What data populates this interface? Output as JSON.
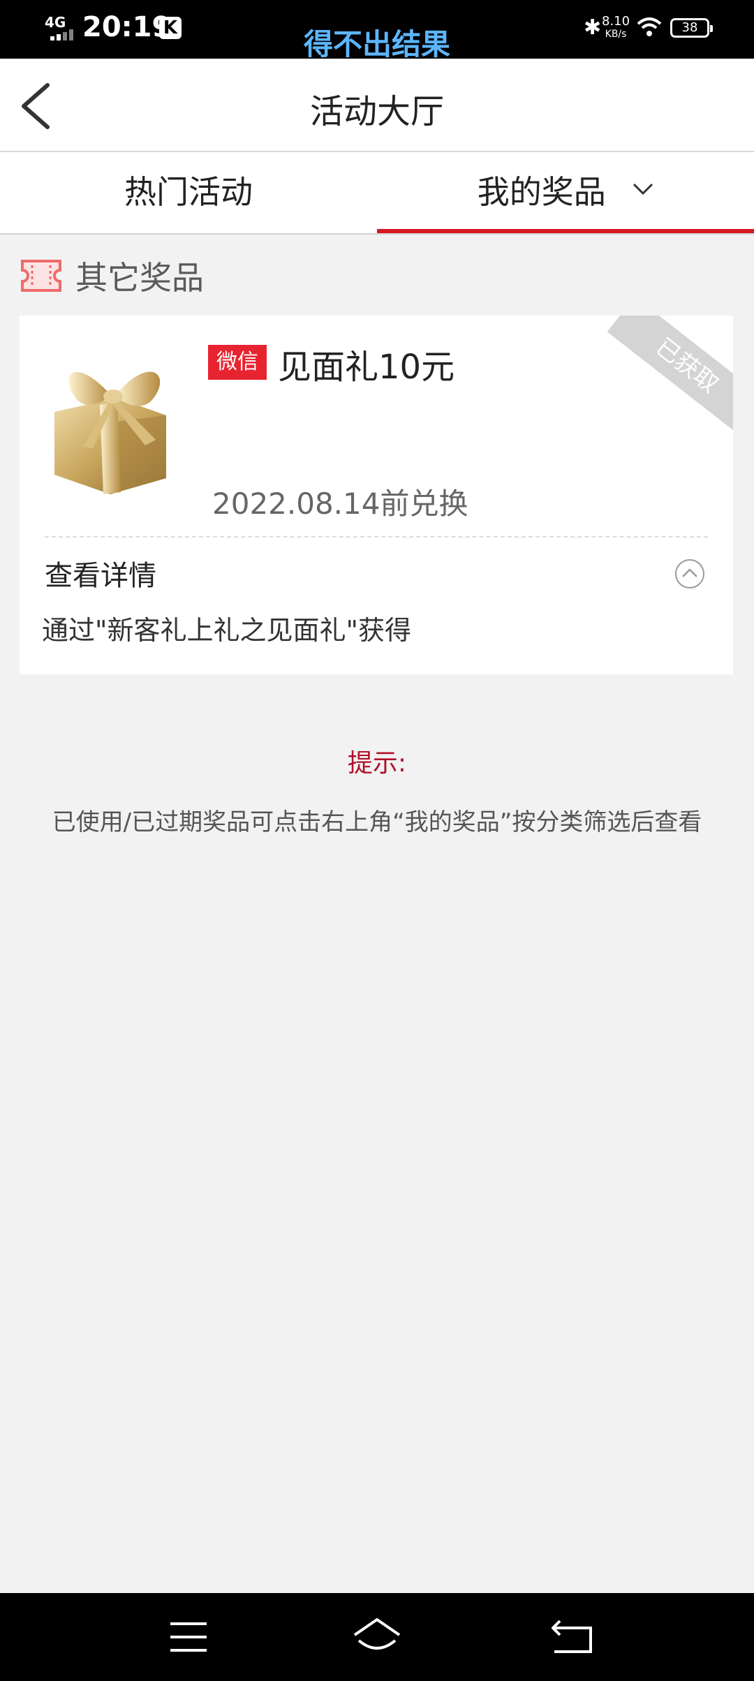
{
  "status_bar": {
    "network": "4G",
    "time": "20:19",
    "app_badge": "K",
    "center_overlay": "得不出结果",
    "speed_value": "8.10",
    "speed_unit": "KB/s",
    "battery": "38"
  },
  "header": {
    "title": "活动大厅"
  },
  "tabs": [
    {
      "label": "热门活动",
      "active": false
    },
    {
      "label": "我的奖品",
      "active": true
    }
  ],
  "section": {
    "title": "其它奖品"
  },
  "prize_card": {
    "badge": "微信",
    "name": "见面礼10元",
    "expiry": "2022.08.14前兑换",
    "status_ribbon": "已获取",
    "detail_label": "查看详情",
    "source": "通过\"新客礼上礼之见面礼\"获得"
  },
  "hint": {
    "title": "提示:",
    "text": "已使用/已过期奖品可点击右上角“我的奖品”按分类筛选后查看"
  },
  "colors": {
    "accent_red": "#d8191f",
    "badge_red": "#e82330",
    "hint_red": "#b0102a",
    "status_blue": "#5cb6ff"
  },
  "icons": {
    "back": "chevron-left-icon",
    "tab_dropdown": "chevron-down-icon",
    "section": "ticket-icon",
    "detail_toggle": "chevron-up-circle-icon",
    "nav_menu": "menu-icon",
    "nav_home": "home-icon",
    "nav_back": "back-icon"
  }
}
